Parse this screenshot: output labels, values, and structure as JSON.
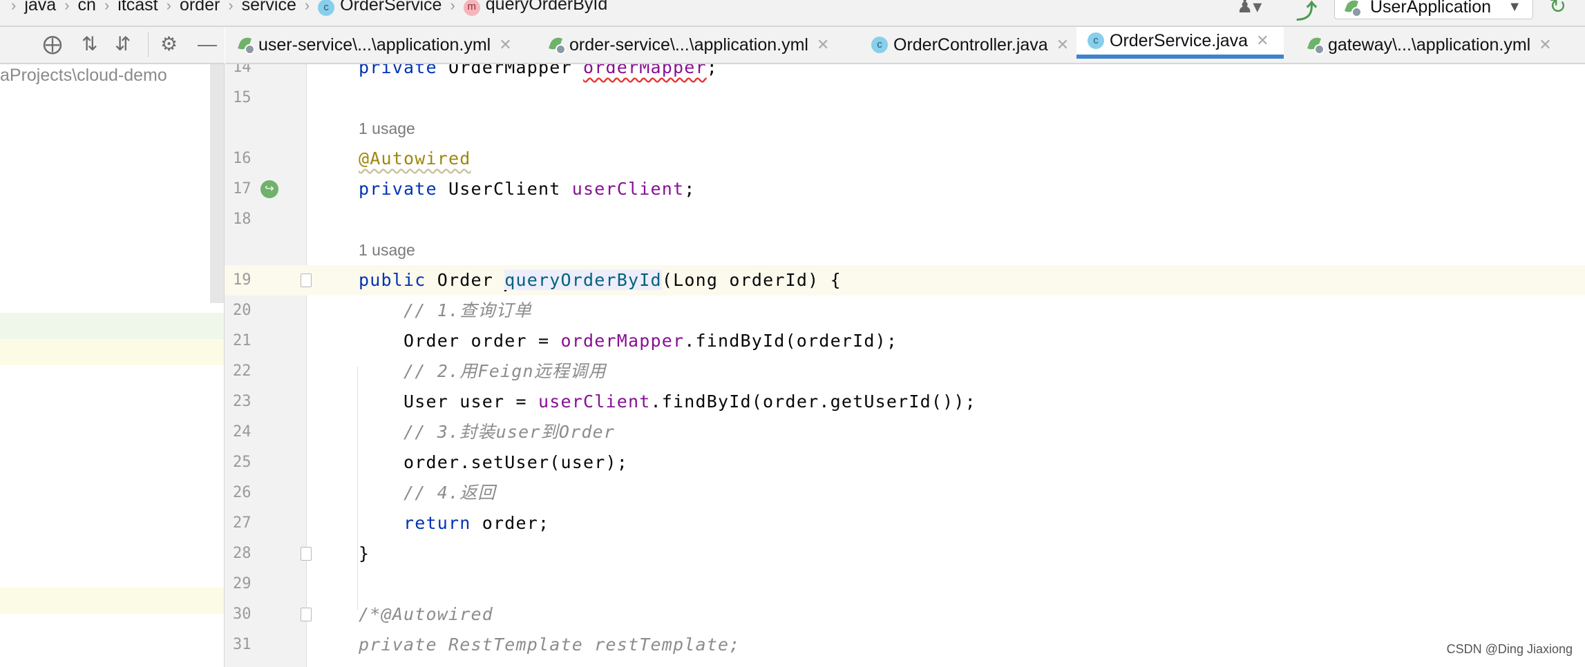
{
  "breadcrumb": [
    {
      "label": "java",
      "icon": null
    },
    {
      "label": "cn",
      "icon": null
    },
    {
      "label": "itcast",
      "icon": null
    },
    {
      "label": "order",
      "icon": null
    },
    {
      "label": "service",
      "icon": null
    },
    {
      "label": "OrderService",
      "icon": "class-icon",
      "glyph": "c"
    },
    {
      "label": "queryOrderById",
      "icon": "method-icon",
      "glyph": "m"
    }
  ],
  "run_config": {
    "label": "UserApplication"
  },
  "project": {
    "path": "aProjects\\cloud-demo"
  },
  "tabs": [
    {
      "label": "user-service\\...\\application.yml",
      "icon": "yml-spring-icon",
      "active": false
    },
    {
      "label": "order-service\\...\\application.yml",
      "icon": "yml-spring-icon",
      "active": false
    },
    {
      "label": "OrderController.java",
      "icon": "class-icon",
      "active": false
    },
    {
      "label": "OrderService.java",
      "icon": "class-icon",
      "active": true
    },
    {
      "label": "gateway\\...\\application.yml",
      "icon": "yml-spring-icon",
      "active": false
    }
  ],
  "colors": {
    "keyword": "#0033b3",
    "field": "#871094",
    "annotation": "#9e880d",
    "comment": "#8c8c8c",
    "method": "#00627a",
    "active_tab": "#4083c9"
  },
  "code": [
    {
      "ln": "14",
      "tokens": [
        [
          "private ",
          "kw"
        ],
        [
          "OrderMapper ",
          ""
        ],
        [
          "orderMapper",
          "fld err"
        ],
        [
          ";",
          ""
        ]
      ]
    },
    {
      "ln": "15",
      "tokens": []
    },
    {
      "hint": "1 usage"
    },
    {
      "ln": "16",
      "tokens": [
        [
          "@Autowired",
          "ann"
        ]
      ]
    },
    {
      "ln": "17",
      "gutter_icon": "spring-bean-icon",
      "tokens": [
        [
          "private ",
          "kw"
        ],
        [
          "UserClient ",
          ""
        ],
        [
          "userClient",
          "fld"
        ],
        [
          ";",
          ""
        ]
      ]
    },
    {
      "ln": "18",
      "tokens": []
    },
    {
      "hint": "1 usage"
    },
    {
      "ln": "19",
      "current": true,
      "fold": true,
      "tokens": [
        [
          "public ",
          "kw"
        ],
        [
          "Order ",
          ""
        ],
        [
          "|",
          "caret"
        ],
        [
          "queryOrderById",
          "mth"
        ],
        [
          "(Long orderId) {",
          ""
        ]
      ]
    },
    {
      "ln": "20",
      "tokens": [
        [
          "    // 1.查询订单",
          "cmt"
        ]
      ]
    },
    {
      "ln": "21",
      "tokens": [
        [
          "    Order order = ",
          ""
        ],
        [
          "orderMapper",
          "fld"
        ],
        [
          ".findById(orderId);",
          ""
        ]
      ]
    },
    {
      "ln": "22",
      "tokens": [
        [
          "    // 2.用Feign远程调用",
          "cmt"
        ]
      ]
    },
    {
      "ln": "23",
      "tokens": [
        [
          "    User user = ",
          ""
        ],
        [
          "userClient",
          "fld"
        ],
        [
          ".findById(order.getUserId());",
          ""
        ]
      ]
    },
    {
      "ln": "24",
      "tokens": [
        [
          "    // 3.封装user到Order",
          "cmt"
        ]
      ]
    },
    {
      "ln": "25",
      "tokens": [
        [
          "    order.setUser(user);",
          ""
        ]
      ]
    },
    {
      "ln": "26",
      "tokens": [
        [
          "    // 4.返回",
          "cmt"
        ]
      ]
    },
    {
      "ln": "27",
      "tokens": [
        [
          "    ",
          ""
        ],
        [
          "return ",
          "kw"
        ],
        [
          "order;",
          ""
        ]
      ]
    },
    {
      "ln": "28",
      "fold": true,
      "tokens": [
        [
          "}",
          ""
        ]
      ]
    },
    {
      "ln": "29",
      "tokens": []
    },
    {
      "ln": "30",
      "fold": true,
      "tokens": [
        [
          "/*@Autowired",
          "cmt"
        ]
      ]
    },
    {
      "ln": "31",
      "tokens": [
        [
          "private RestTemplate restTemplate;",
          "cmt"
        ]
      ]
    }
  ],
  "watermark": "CSDN @Ding Jiaxiong"
}
